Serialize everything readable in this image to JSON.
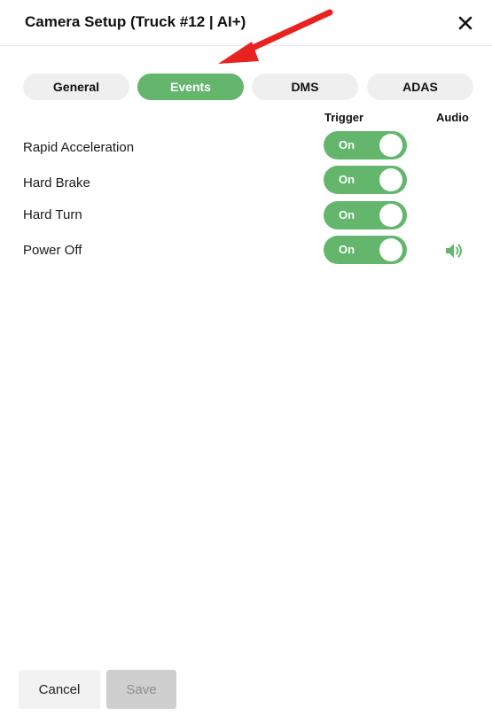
{
  "header": {
    "title": "Camera Setup (Truck #12 | AI+)",
    "close_icon": "close-icon"
  },
  "tabs": [
    {
      "label": "General",
      "active": false
    },
    {
      "label": "Events",
      "active": true
    },
    {
      "label": "DMS",
      "active": false
    },
    {
      "label": "ADAS",
      "active": false
    }
  ],
  "columns": {
    "trigger": "Trigger",
    "audio": "Audio"
  },
  "events": [
    {
      "label": "Rapid Acceleration",
      "trigger": "On",
      "audio_icon": null
    },
    {
      "label": "Hard Brake",
      "trigger": "On",
      "audio_icon": null
    },
    {
      "label": "Hard Turn",
      "trigger": "On",
      "audio_icon": null
    },
    {
      "label": "Power Off",
      "trigger": "On",
      "audio_icon": "speaker-icon"
    }
  ],
  "footer": {
    "cancel_label": "Cancel",
    "save_label": "Save",
    "save_enabled": false
  },
  "annotation": {
    "arrow_color": "#e8231f"
  },
  "colors": {
    "accent": "#63b66c",
    "tab_inactive": "#efefef",
    "button_disabled": "#cfcfcf"
  }
}
